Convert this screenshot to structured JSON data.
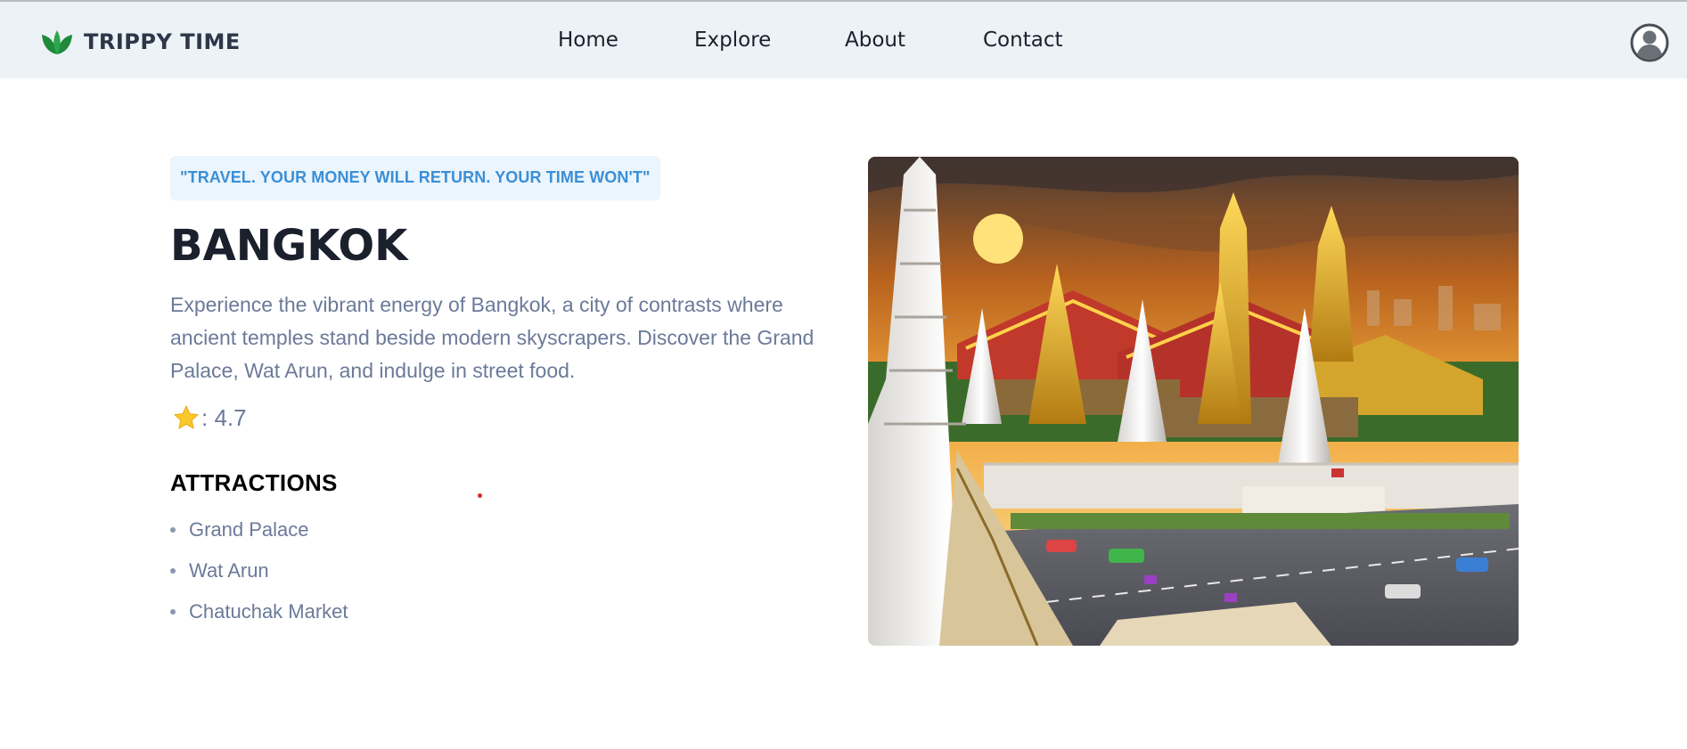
{
  "brand": {
    "name": "TRIPPY TIME",
    "color": "#1f8a3b"
  },
  "nav": {
    "links": [
      {
        "label": "Home"
      },
      {
        "label": "Explore"
      },
      {
        "label": "About"
      },
      {
        "label": "Contact"
      }
    ]
  },
  "destination": {
    "quote": "\"TRAVEL. YOUR MONEY WILL RETURN. YOUR TIME WON'T\"",
    "name": "BANGKOK",
    "description": "Experience the vibrant energy of Bangkok, a city of contrasts where ancient temples stand beside modern skyscrapers. Discover the Grand Palace, Wat Arun, and indulge in street food.",
    "rating_text": ": 4.7",
    "rating_icon": "star-icon",
    "attractions_title": "ATTRACTIONS",
    "attractions": [
      "Grand Palace",
      "Wat Arun",
      "Chatuchak Market"
    ]
  },
  "colors": {
    "navbar_bg": "#edf2f7",
    "accent_blue": "#3b8fd6",
    "quote_bg": "#ebf5fd",
    "text_muted": "#6b7a99"
  }
}
